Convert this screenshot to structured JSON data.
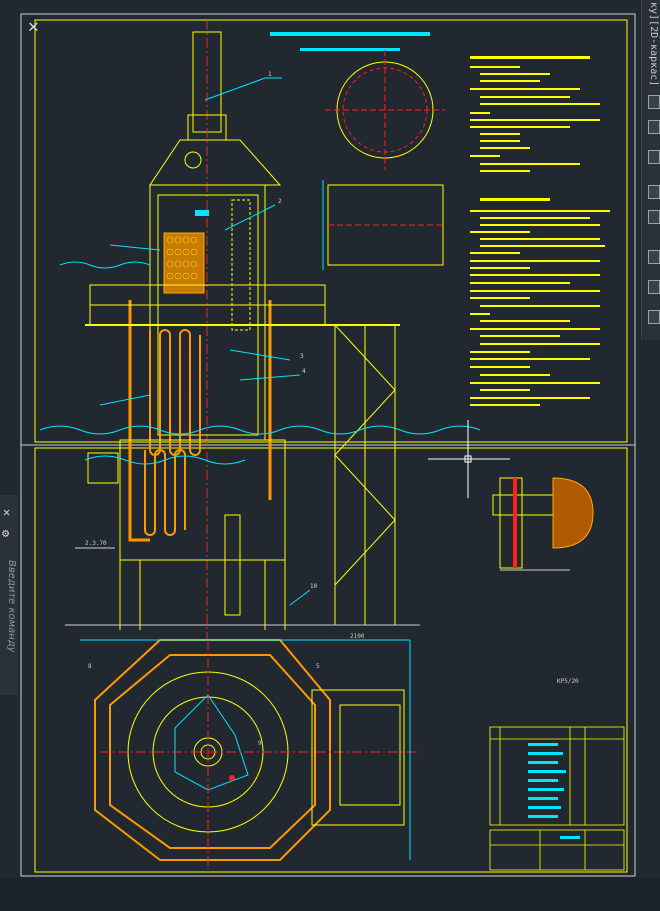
{
  "viewport": {
    "view_label": "ку][2D-каркас]"
  },
  "command_line": {
    "placeholder": "Введите команду"
  },
  "drawing": {
    "labels": {
      "tbl_size": "КР5/20",
      "dim_width": "2100",
      "leader_1": "1",
      "leader_2": "2",
      "leader_3": "3",
      "leader_4": "4",
      "leader_5": "5",
      "leader_8": "8",
      "leader_9": "9",
      "leader_10": "10",
      "elev_1": "2.3.70"
    }
  },
  "colors": {
    "accent_cyan": "#00e5ff",
    "accent_yellow": "#ffff00",
    "accent_red": "#ff2020"
  }
}
